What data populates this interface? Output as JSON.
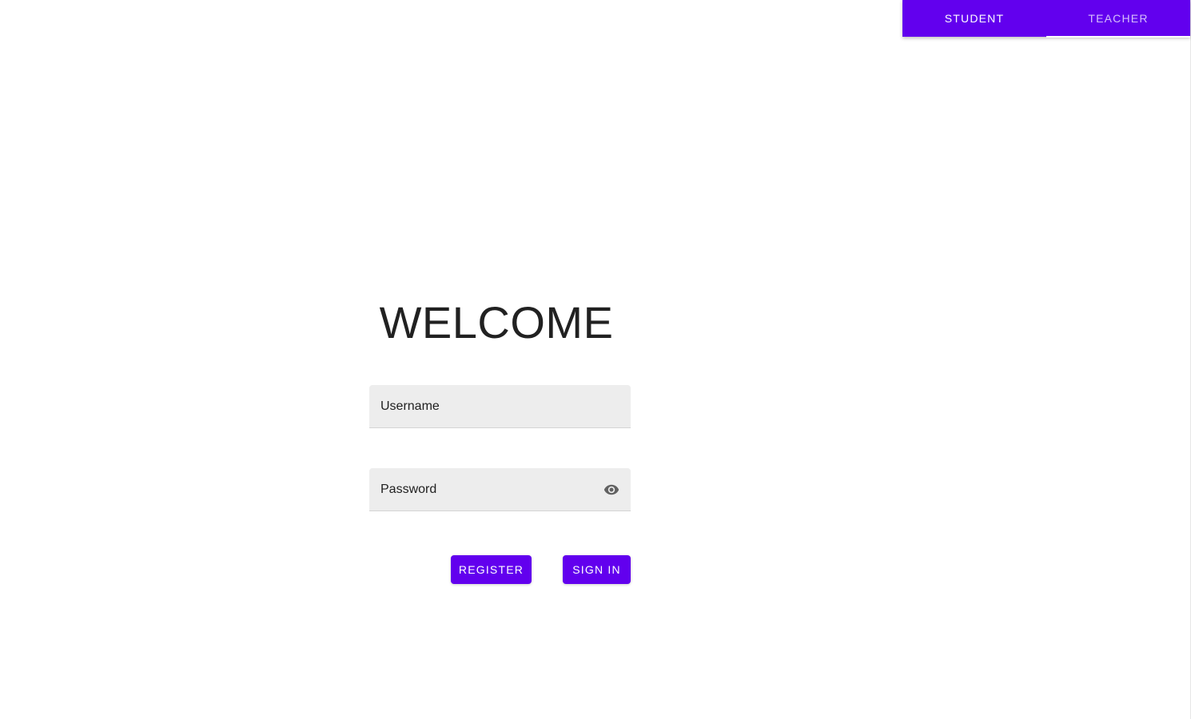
{
  "colors": {
    "primary": "#6200ee",
    "field_background": "#ededed",
    "text": "#212121"
  },
  "tabs": [
    {
      "label": "STUDENT",
      "selected": true
    },
    {
      "label": "TEACHER",
      "selected": false
    }
  ],
  "login": {
    "title": "WELCOME",
    "username_placeholder": "Username",
    "password_placeholder": "Password",
    "password_toggle_icon": "eye-icon",
    "register_label": "REGISTER",
    "signin_label": "SIGN IN"
  }
}
